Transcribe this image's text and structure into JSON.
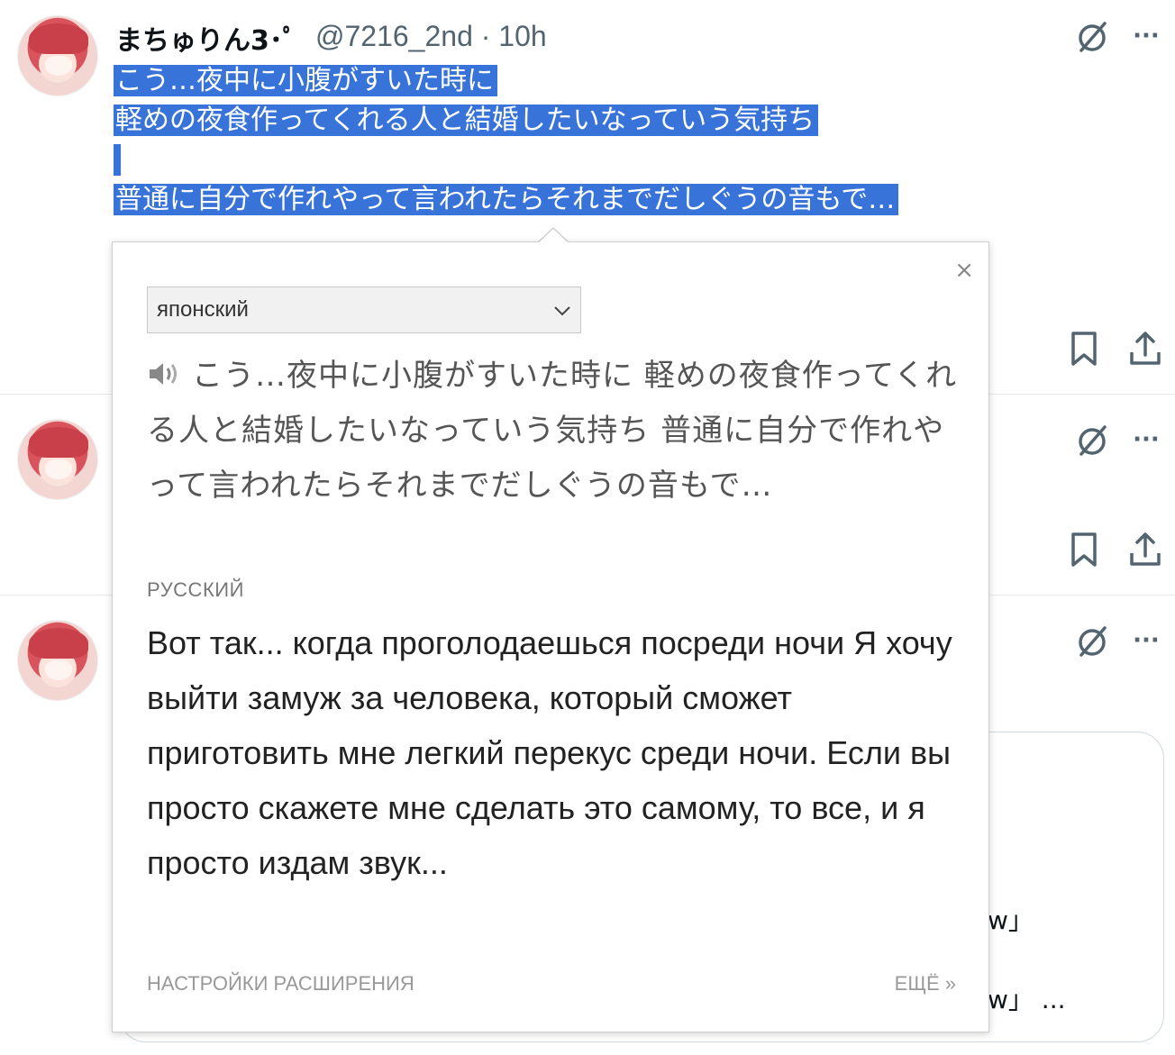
{
  "tweet": {
    "author_name": "まちゅりん3･ﾟ",
    "handle_time": "@7216_2nd · 10h",
    "selected_lines": [
      "こう…夜中に小腹がすいた時に",
      "軽めの夜食作ってくれる人と結婚したいなっていう気持ち",
      "",
      "普通に自分で作れやって言われたらそれまでだしぐうの音もで…"
    ]
  },
  "icons": {
    "grok": "slashed-circle-icon",
    "more": "more-icon",
    "bookmark": "bookmark-icon",
    "share": "share-icon"
  },
  "more_glyph": "···",
  "popup": {
    "close_glyph": "×",
    "source_lang": "японский",
    "source_text": "こう…夜中に小腹がすいた時に 軽めの夜食作ってくれる人と結婚したいなっていう気持ち 普通に自分で作れやって言われたらそれまでだしぐうの音もで…",
    "target_lang": "РУССКИЙ",
    "translation": "Вот так... когда проголодаешься посреди ночи Я хочу выйти замуж за человека, который сможет приготовить мне легкий перекус среди ночи. Если вы просто скажете мне сделать это самому, то все, и я просто издам звук...",
    "settings_link": "НАСТРОЙКИ РАСШИРЕНИЯ",
    "more_link": "ЕЩЁ »"
  },
  "card": {
    "line1": "w」",
    "line2": "w」 ..."
  },
  "colors": {
    "selection": "#3873d9",
    "icon": "#536471"
  }
}
